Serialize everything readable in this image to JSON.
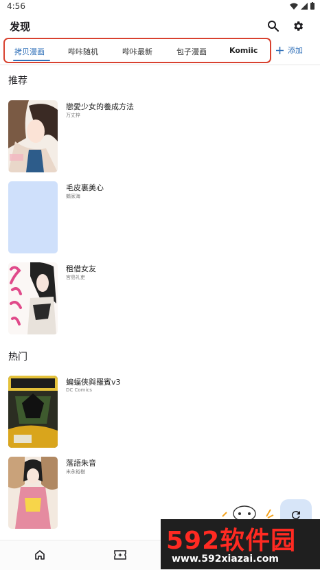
{
  "status": {
    "time": "4:56"
  },
  "appbar": {
    "title": "发现"
  },
  "tabs": [
    {
      "label": "拷贝漫画",
      "active": true
    },
    {
      "label": "哔咔随机",
      "active": false
    },
    {
      "label": "哔咔最新",
      "active": false
    },
    {
      "label": "包子漫画",
      "active": false
    },
    {
      "label": "Komiic",
      "active": false
    }
  ],
  "add_label": "添加",
  "sections": {
    "recommend": {
      "title": "推荐",
      "items": [
        {
          "name": "戀愛少女的養成方法",
          "author": "万丈梓"
        },
        {
          "name": "毛皮裏美心",
          "author": "鵺家海"
        },
        {
          "name": "租借女友",
          "author": "宮島礼吏"
        }
      ]
    },
    "hot": {
      "title": "热门",
      "items": [
        {
          "name": "蝙蝠俠與羅賓v3",
          "author": "DC Comics"
        },
        {
          "name": "落語朱音",
          "author": "末永裕樹"
        }
      ]
    }
  },
  "watermark": {
    "main": "592软件园",
    "url": "www.592xiazai.com"
  },
  "colors": {
    "accent": "#2f6fb8",
    "highlight_border": "#d8412f",
    "fab_bg": "#d7e5f8"
  },
  "icons": [
    "search-icon",
    "settings-gear-icon",
    "plus-icon",
    "refresh-icon",
    "home-icon",
    "ticket-icon"
  ]
}
